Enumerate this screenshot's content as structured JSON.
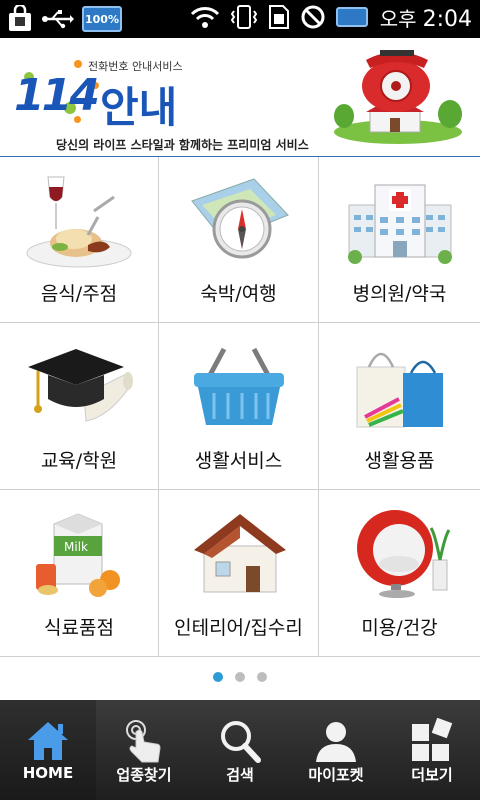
{
  "status_bar": {
    "battery_badge": "100%",
    "ampm": "오후",
    "time": "2:04"
  },
  "header": {
    "logo_number": "114",
    "logo_text": "안내",
    "logo_subtitle": "전화번호 안내서비스",
    "tagline": "당신의 라이프 스타일과 함께하는 프리미엄 서비스"
  },
  "categories": [
    {
      "label": "음식/주점",
      "icon": "dining-icon"
    },
    {
      "label": "숙박/여행",
      "icon": "compass-map-icon"
    },
    {
      "label": "병의원/약국",
      "icon": "hospital-icon"
    },
    {
      "label": "교육/학원",
      "icon": "graduation-cap-icon"
    },
    {
      "label": "생활서비스",
      "icon": "basket-icon"
    },
    {
      "label": "생활용품",
      "icon": "shopping-bags-icon"
    },
    {
      "label": "식료품점",
      "icon": "groceries-icon"
    },
    {
      "label": "인테리어/집수리",
      "icon": "house-icon"
    },
    {
      "label": "미용/건강",
      "icon": "egg-chair-icon"
    }
  ],
  "pager": {
    "pages": 3,
    "active": 0
  },
  "bottom_nav": [
    {
      "label": "HOME",
      "icon": "home-icon",
      "active": true
    },
    {
      "label": "업종찾기",
      "icon": "touch-finger-icon",
      "active": false
    },
    {
      "label": "검색",
      "icon": "search-icon",
      "active": false
    },
    {
      "label": "마이포켓",
      "icon": "person-icon",
      "active": false
    },
    {
      "label": "더보기",
      "icon": "more-tiles-icon",
      "active": false
    }
  ],
  "colors": {
    "brand_blue": "#1a56b8",
    "pager_active": "#2d9bd6",
    "nav_active_icon": "#4a9be8"
  }
}
